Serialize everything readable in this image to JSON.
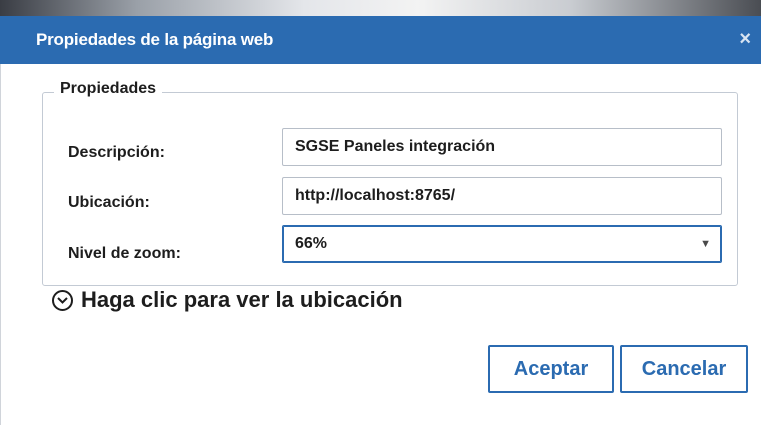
{
  "dialog": {
    "title": "Propiedades de la página web",
    "close_label": "×"
  },
  "properties": {
    "legend": "Propiedades",
    "description": {
      "label": "Descripción:",
      "value": "SGSE Paneles integración"
    },
    "location": {
      "label": "Ubicación:",
      "value": "http://localhost:8765/"
    },
    "zoom": {
      "label": "Nivel de zoom:",
      "value": "66%",
      "arrow": "▼"
    }
  },
  "expander": {
    "label": "Haga clic para ver la ubicación"
  },
  "buttons": {
    "accept": "Aceptar",
    "cancel": "Cancelar"
  },
  "colors": {
    "accent": "#2b6bb1",
    "text": "#1d1d1d"
  },
  "icons": {
    "close": "close-icon",
    "expander": "chevron-down-circle-icon",
    "dropdown": "dropdown-arrow-icon"
  }
}
